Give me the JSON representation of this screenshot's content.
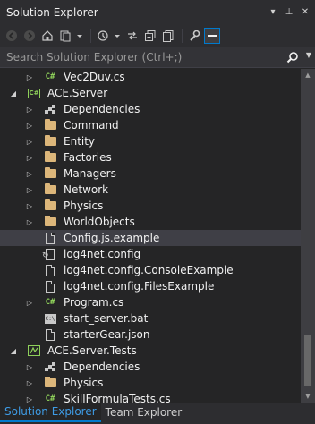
{
  "window": {
    "title": "Solution Explorer",
    "controls": [
      "▾",
      "⊥",
      "✕"
    ]
  },
  "toolbar": {
    "buttons": [
      "back-icon",
      "forward-icon",
      "home-icon",
      "switch-views-icon",
      "pending-changes-icon",
      "collapse-all-icon",
      "show-all-files-icon",
      "properties-icon",
      "preview-icon"
    ]
  },
  "search": {
    "placeholder": "Search Solution Explorer (Ctrl+;)"
  },
  "tree": [
    {
      "label": "Vec2Duv.cs",
      "icon": "csharp-file-icon",
      "expander": "▷"
    },
    {
      "label": "ACE.Server",
      "icon": "csharp-project-icon",
      "expander": "◢"
    },
    {
      "label": "Dependencies",
      "icon": "dependencies-icon",
      "expander": "▷"
    },
    {
      "label": "Command",
      "icon": "folder-icon",
      "expander": "▷"
    },
    {
      "label": "Entity",
      "icon": "folder-icon",
      "expander": "▷"
    },
    {
      "label": "Factories",
      "icon": "folder-icon",
      "expander": "▷"
    },
    {
      "label": "Managers",
      "icon": "folder-icon",
      "expander": "▷"
    },
    {
      "label": "Network",
      "icon": "folder-icon",
      "expander": "▷"
    },
    {
      "label": "Physics",
      "icon": "folder-icon",
      "expander": "▷"
    },
    {
      "label": "WorldObjects",
      "icon": "folder-icon",
      "expander": "▷"
    },
    {
      "label": "Config.js.example",
      "icon": "file-icon",
      "expander": ""
    },
    {
      "label": "log4net.config",
      "icon": "config-file-icon",
      "expander": ""
    },
    {
      "label": "log4net.config.ConsoleExample",
      "icon": "file-icon",
      "expander": ""
    },
    {
      "label": "log4net.config.FilesExample",
      "icon": "file-icon",
      "expander": ""
    },
    {
      "label": "Program.cs",
      "icon": "csharp-file-icon",
      "expander": "▷"
    },
    {
      "label": "start_server.bat",
      "icon": "batch-file-icon",
      "expander": ""
    },
    {
      "label": "starterGear.json",
      "icon": "file-icon",
      "expander": ""
    },
    {
      "label": "ACE.Server.Tests",
      "icon": "test-project-icon",
      "expander": "◢"
    },
    {
      "label": "Dependencies",
      "icon": "dependencies-icon",
      "expander": "▷"
    },
    {
      "label": "Physics",
      "icon": "folder-icon",
      "expander": "▷"
    },
    {
      "label": "SkillFormulaTests.cs",
      "icon": "csharp-file-icon",
      "expander": "▷"
    }
  ],
  "selected_item": "Config.js.example",
  "tabs": [
    {
      "label": "Solution Explorer",
      "active": true
    },
    {
      "label": "Team Explorer",
      "active": false
    }
  ],
  "colors": {
    "background": "#252526",
    "accent": "#007acc",
    "folder": "#dcb67a",
    "csharp": "#8ed05a",
    "selection": "#3f3f46"
  }
}
